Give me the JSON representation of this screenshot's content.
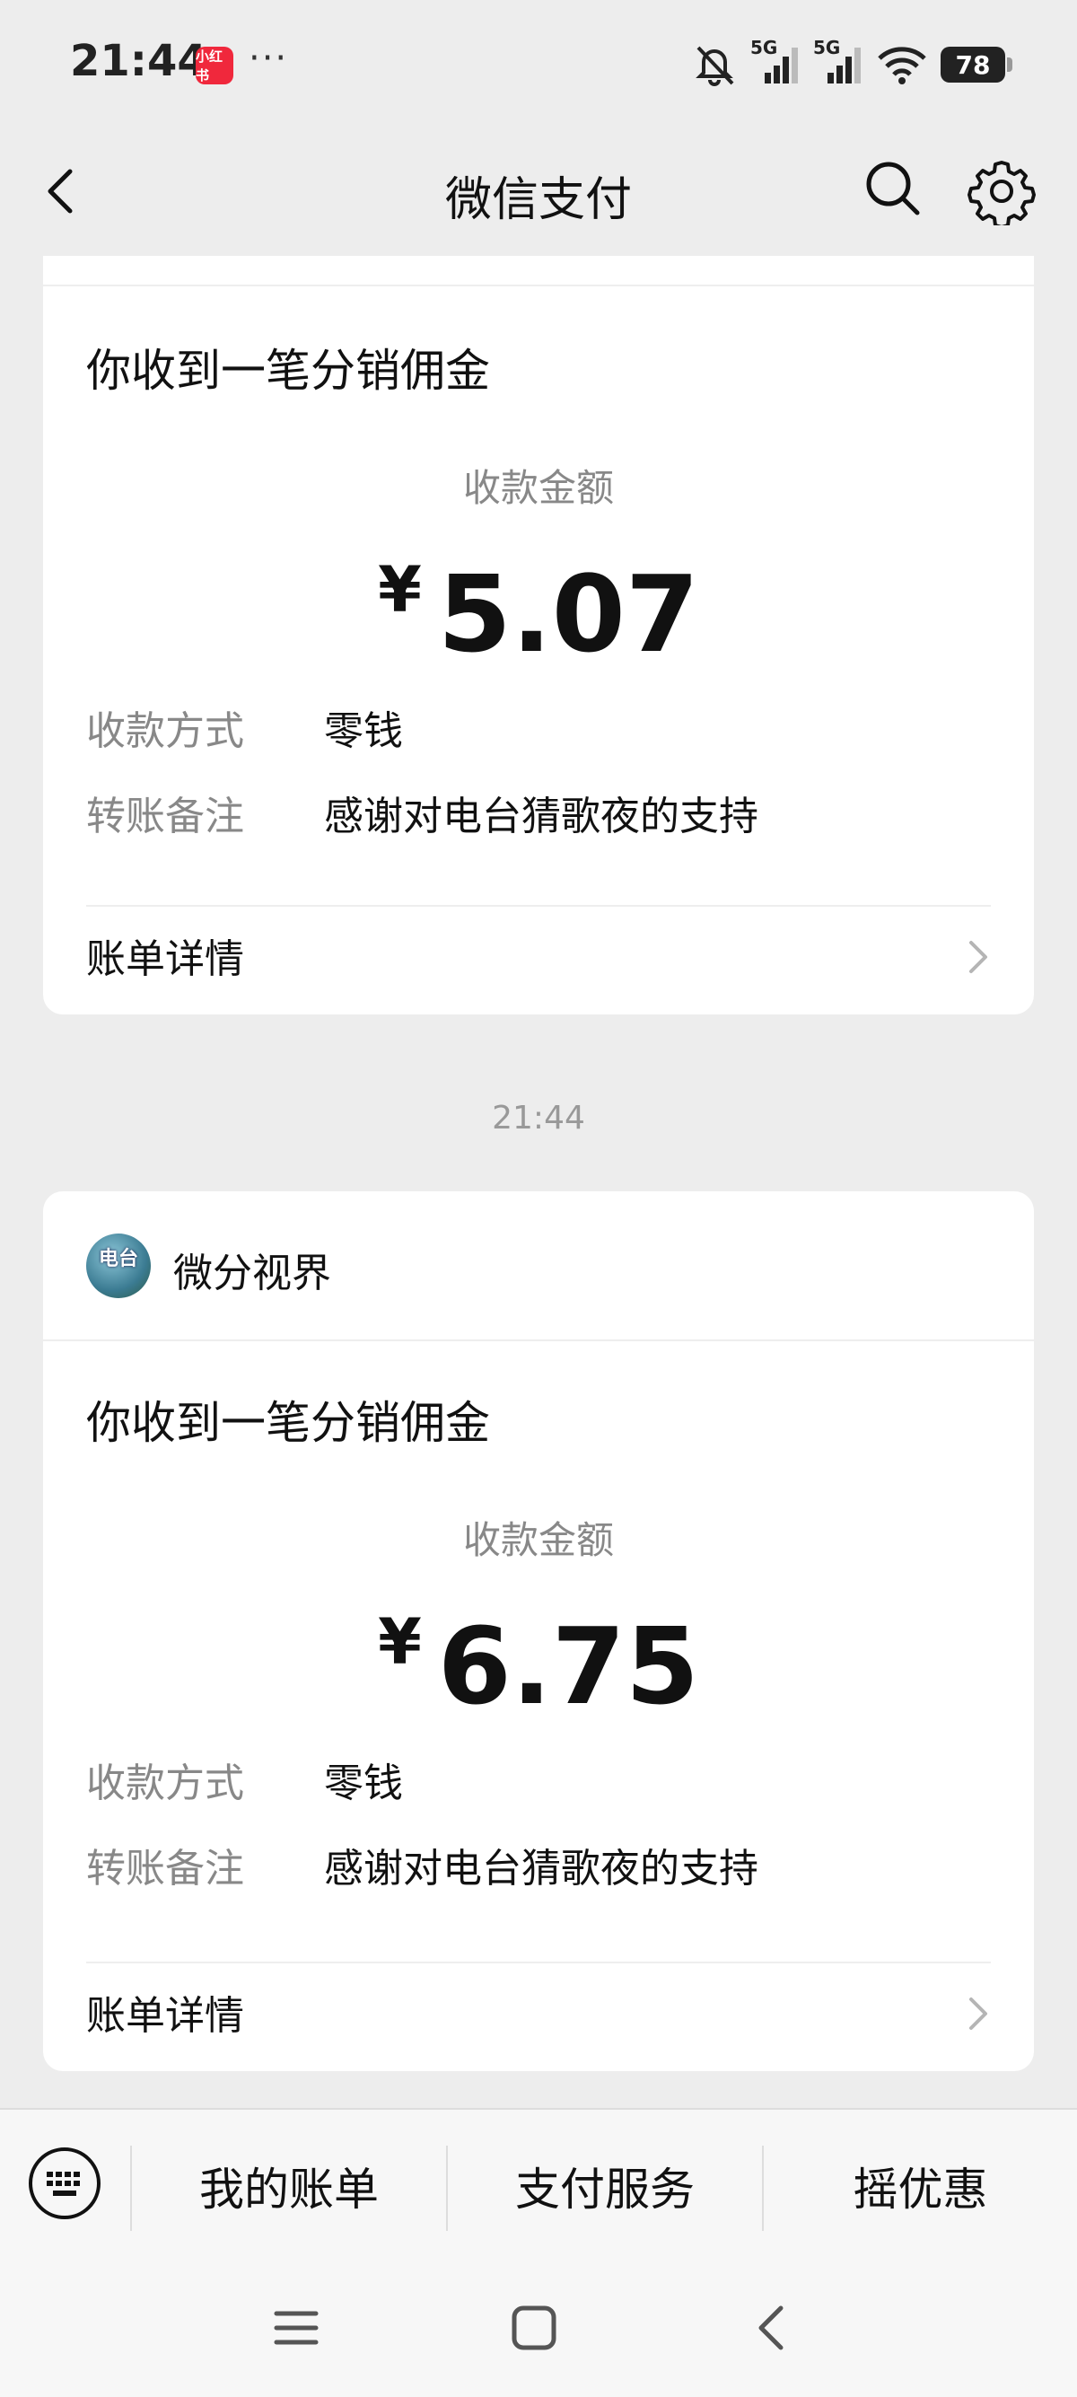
{
  "status_bar": {
    "time": "21:44",
    "app_badge": "小红书",
    "more": "···",
    "signal1_tag": "5G",
    "signal2_tag": "5G",
    "battery": "78"
  },
  "nav": {
    "title": "微信支付"
  },
  "messages": [
    {
      "title": "你收到一笔分销佣金",
      "amount_label": "收款金额",
      "currency": "¥",
      "amount": "5.07",
      "method_label": "收款方式",
      "method_value": "零钱",
      "note_label": "转账备注",
      "note_value": "感谢对电台猜歌夜的支持",
      "detail_label": "账单详情"
    },
    {
      "timestamp": "21:44",
      "sender": "微分视界",
      "avatar_text": "电台",
      "title": "你收到一笔分销佣金",
      "amount_label": "收款金额",
      "currency": "¥",
      "amount": "6.75",
      "method_label": "收款方式",
      "method_value": "零钱",
      "note_label": "转账备注",
      "note_value": "感谢对电台猜歌夜的支持",
      "detail_label": "账单详情"
    }
  ],
  "bottom_menu": {
    "items": [
      "我的账单",
      "支付服务",
      "摇优惠"
    ]
  },
  "icons": {
    "back": "back-icon",
    "search": "search-icon",
    "settings": "gear-icon",
    "keyboard": "keyboard-icon",
    "chevron": "chevron-right-icon"
  }
}
